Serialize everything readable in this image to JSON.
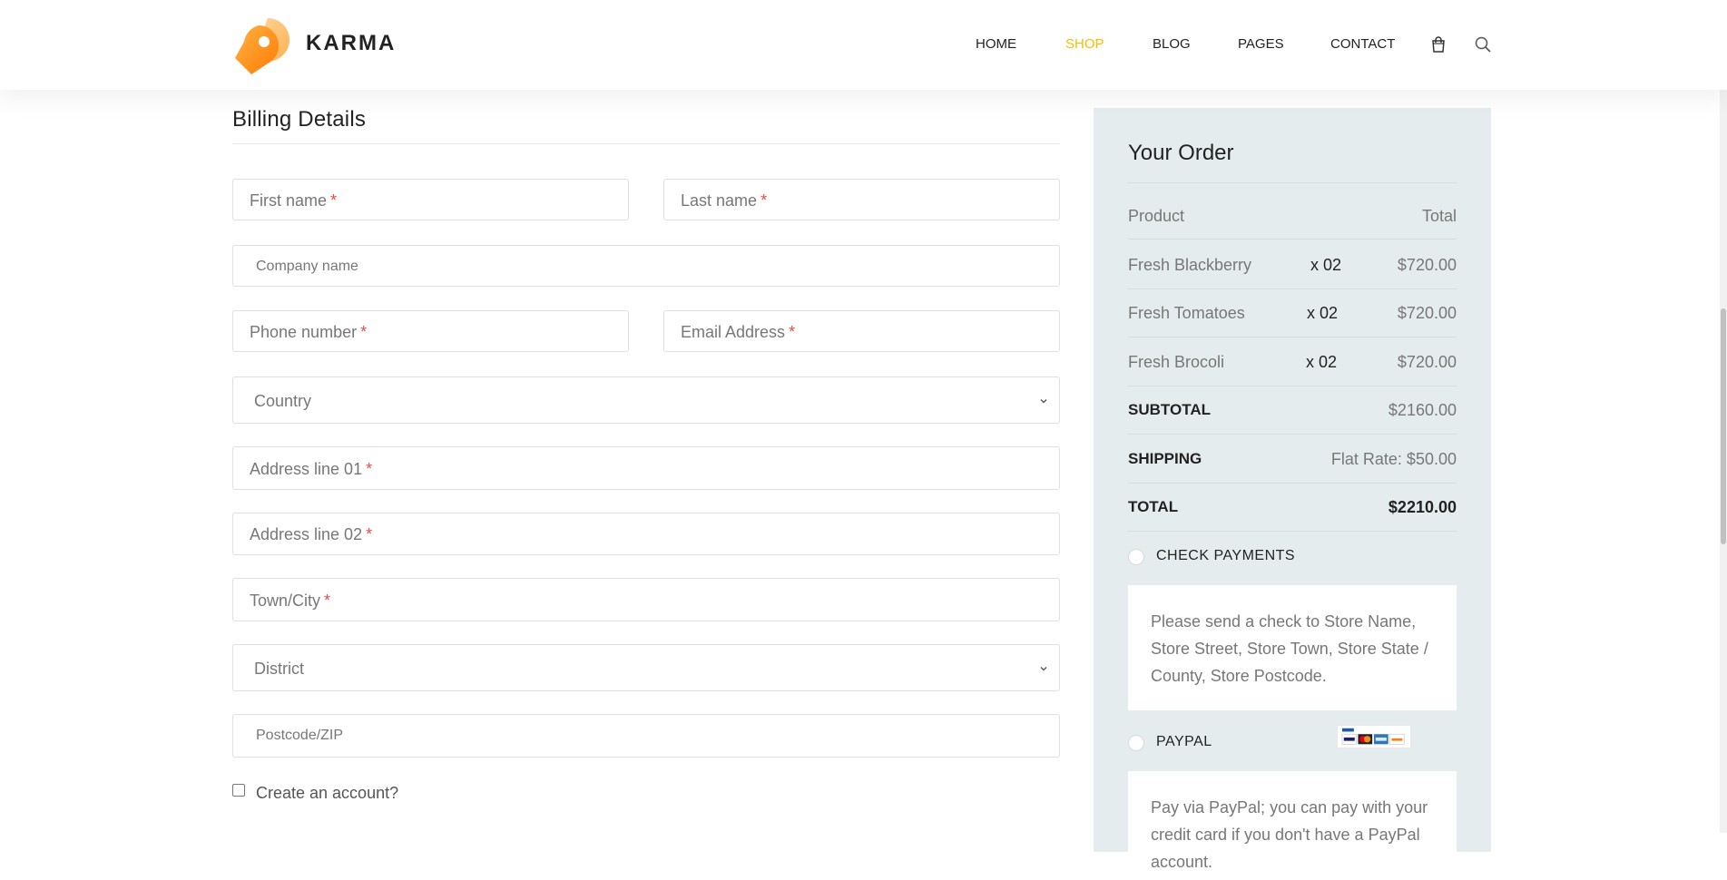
{
  "brand": {
    "name": "KARMA"
  },
  "nav": {
    "items": [
      {
        "label": "HOME"
      },
      {
        "label": "SHOP"
      },
      {
        "label": "BLOG"
      },
      {
        "label": "PAGES"
      },
      {
        "label": "CONTACT"
      }
    ],
    "active": "SHOP",
    "icons": [
      "shopping-bag-icon",
      "search-icon"
    ]
  },
  "billing": {
    "title": "Billing Details",
    "first_name": "First name",
    "last_name": "Last name",
    "company": "Company name",
    "phone": "Phone number",
    "email": "Email Address",
    "country": "Country",
    "address1": "Address line 01",
    "address2": "Address line 02",
    "town": "Town/City",
    "district": "District",
    "postcode": "Postcode/ZIP",
    "required_mark": "*",
    "create_account": "Create an account?"
  },
  "order": {
    "title": "Your Order",
    "header": {
      "product": "Product",
      "total": "Total"
    },
    "items": [
      {
        "name": "Fresh Blackberry",
        "qty": "x 02",
        "price": "$720.00"
      },
      {
        "name": "Fresh Tomatoes",
        "qty": "x 02",
        "price": "$720.00"
      },
      {
        "name": "Fresh Brocoli",
        "qty": "x 02",
        "price": "$720.00"
      }
    ],
    "subtotal": {
      "label": "SUBTOTAL",
      "value": "$2160.00"
    },
    "shipping": {
      "label": "SHIPPING",
      "value": "Flat Rate: $50.00"
    },
    "total": {
      "label": "TOTAL",
      "value": "$2210.00"
    },
    "payments": {
      "check_label": "CHECK PAYMENTS",
      "check_desc": "Please send a check to Store Name, Store Street, Store Town, Store State / County, Store Postcode.",
      "paypal_label": "PAYPAL",
      "paypal_desc": "Pay via PayPal; you can pay with your credit card if you don't have a PayPal account."
    }
  },
  "colors": {
    "accent": "#ffba00",
    "logo_orange": "#ff8a00",
    "required": "#e54d42",
    "order_bg": "#e5ecee"
  }
}
